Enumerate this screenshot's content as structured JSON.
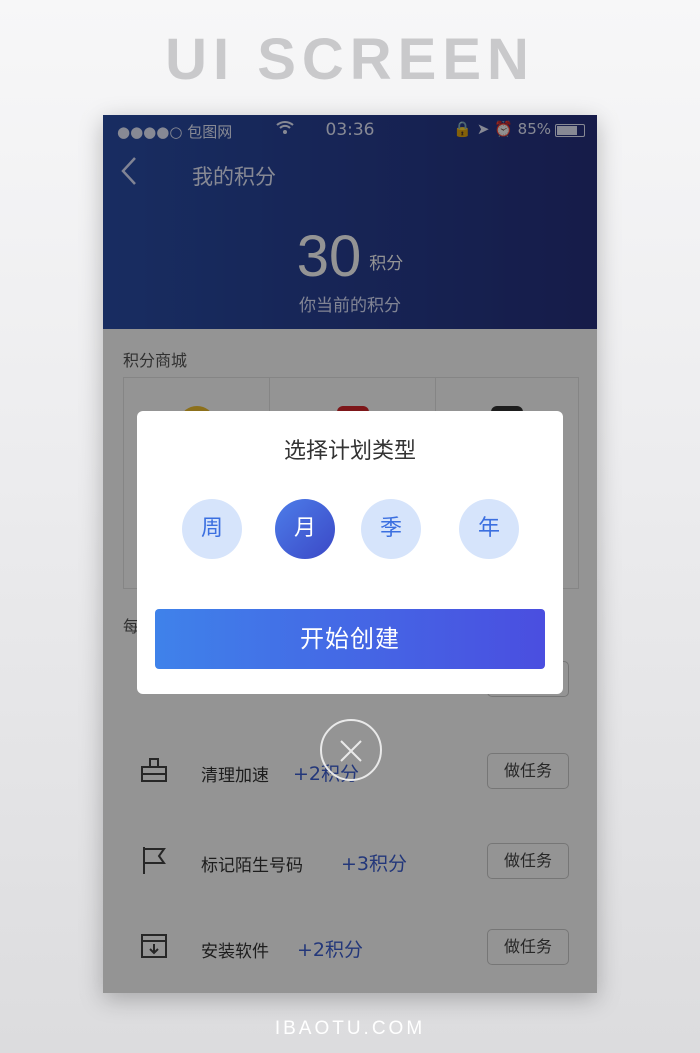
{
  "banner": "UI SCREEN",
  "footer": "IBAOTU.COM",
  "status": {
    "carrier": "●●●●○ 包图网",
    "time": "03:36",
    "right_icons": "🔒 ➤ ⏰",
    "battery": "85%",
    "battery_level": 0.85
  },
  "header": {
    "back_icon": "chevron-left-icon",
    "title": "我的积分",
    "points_value": "30",
    "points_unit": "积分",
    "subtitle": "你当前的积分"
  },
  "mall": {
    "label": "积分商城"
  },
  "daily": {
    "label": "每"
  },
  "tasks": [
    {
      "icon": "broom-icon",
      "name": "清理加速",
      "points": "+2积分",
      "button": "做任务"
    },
    {
      "icon": "flag-icon",
      "name": "标记陌生号码",
      "points": "+3积分",
      "button": "做任务"
    },
    {
      "icon": "download-box-icon",
      "name": "安装软件",
      "points": "+2积分",
      "button": "做任务"
    }
  ],
  "dialog": {
    "title": "选择计划类型",
    "options": [
      {
        "label": "周",
        "selected": false
      },
      {
        "label": "月",
        "selected": true
      },
      {
        "label": "季",
        "selected": false
      },
      {
        "label": "年",
        "selected": false
      }
    ],
    "start_button": "开始创建",
    "close_icon": "close-circle-icon"
  },
  "colors": {
    "header_start": "#2a4ea8",
    "header_end": "#26307e",
    "accent": "#3f82ea",
    "accent_end": "#4a4ee0",
    "points_text": "#3d5fd2"
  }
}
